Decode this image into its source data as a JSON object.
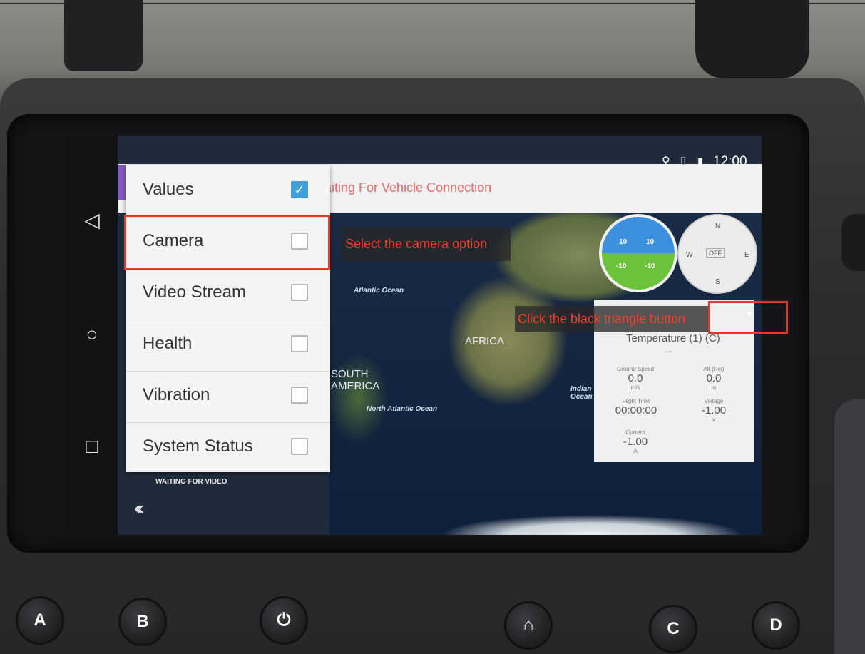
{
  "statusbar": {
    "time": "12:00",
    "location_icon": "location-pin-icon",
    "signal_icon": "signal-icon",
    "battery_icon": "battery-icon"
  },
  "appbar": {
    "status": "aiting For Vehicle Connection"
  },
  "navbar": {
    "back_icon": "back-triangle-icon",
    "home_icon": "home-circle-icon",
    "recents_icon": "recents-square-icon"
  },
  "panel": {
    "items": [
      {
        "label": "Values",
        "checked": true
      },
      {
        "label": "Camera",
        "checked": false
      },
      {
        "label": "Video Stream",
        "checked": false
      },
      {
        "label": "Health",
        "checked": false
      },
      {
        "label": "Vibration",
        "checked": false
      },
      {
        "label": "System Status",
        "checked": false
      }
    ]
  },
  "video": {
    "waiting": "WAITING FOR VIDEO",
    "collapse": "«‹"
  },
  "annotations": {
    "camera": "Select the camera option",
    "dropdown": "Click the black triangle button"
  },
  "map": {
    "labels": [
      "Atlantic Ocean",
      "AFRICA",
      "SOUTH AMERICA",
      "North Atlantic Ocean",
      "Indian Ocean"
    ]
  },
  "instruments": {
    "horizon": {
      "top_left": "10",
      "top_right": "10",
      "bottom_left": "-10",
      "bottom_right": "-10"
    },
    "compass": {
      "n": "N",
      "s": "S",
      "e": "E",
      "w": "W",
      "center": "OFF"
    }
  },
  "values_widget": {
    "title": "Temperature (1) (C)",
    "dash": "---",
    "cells": [
      {
        "label": "Ground Speed",
        "value": "0.0",
        "unit": "m/s"
      },
      {
        "label": "Alt (Rel)",
        "value": "0.0",
        "unit": "m"
      },
      {
        "label": "Flight Time",
        "value": "00:00:00",
        "unit": ""
      },
      {
        "label": "Voltage",
        "value": "-1.00",
        "unit": "v"
      },
      {
        "label": "Current",
        "value": "-1.00",
        "unit": "A"
      }
    ]
  },
  "hardware_buttons": {
    "a": "A",
    "b": "B",
    "power": "⏻",
    "home": "⌂",
    "c": "C",
    "d": "D"
  },
  "colors": {
    "highlight": "#e33a2e",
    "annotation_text": "#ff3b30",
    "check": "#3f9fd6"
  }
}
